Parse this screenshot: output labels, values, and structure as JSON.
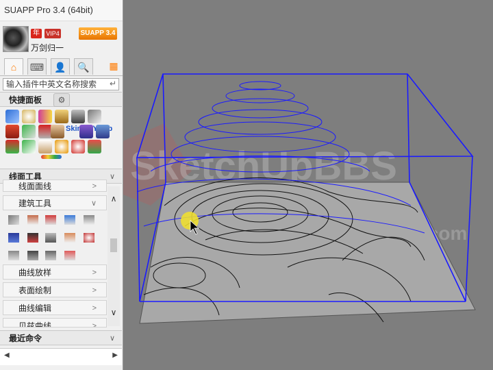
{
  "app": {
    "title": "SUAPP Pro 3.4 (64bit)"
  },
  "user": {
    "name": "万剑归一",
    "badge_year": "年",
    "badge_vip": "VIP4",
    "version_badge": "SUAPP 3.4"
  },
  "tabs": [
    {
      "name": "home-icon",
      "glyph": "⌂"
    },
    {
      "name": "keyboard-icon",
      "glyph": "⌨"
    },
    {
      "name": "user-icon",
      "glyph": "👤"
    },
    {
      "name": "search-icon",
      "glyph": "🔍"
    }
  ],
  "grid_icon": "▦",
  "search": {
    "placeholder": "输入插件中英文名称搜索",
    "enter_glyph": "↵"
  },
  "sections": {
    "quick_panel": {
      "label": "快捷面板",
      "gear_glyph": "⚙"
    },
    "line_tools": {
      "label": "线面工具",
      "chev": "∨"
    },
    "recent": {
      "label": "最近命令",
      "chev": "∨"
    }
  },
  "quick_panel": {
    "skin_label": "SkinX / YBub"
  },
  "subcategories": [
    {
      "label": "线面面线",
      "arrow": ">"
    },
    {
      "label": "建筑工具",
      "arrow": "∨"
    },
    {
      "label": "曲线放样",
      "arrow": ">"
    },
    {
      "label": "表面绘制",
      "arrow": ">"
    },
    {
      "label": "曲线编辑",
      "arrow": ">"
    },
    {
      "label": "贝兹曲线",
      "arrow": ">"
    }
  ],
  "scroll": {
    "up": "∧",
    "down": "∨"
  },
  "recent_bar": {
    "left_arrow": "◀",
    "right_arrow": "▶"
  },
  "watermark": {
    "text": "SketchUpBBS",
    "url": "www.sketchupbar.com"
  },
  "colors": {
    "accent": "#ff7a00",
    "bbox": "#1a1aff",
    "viewport_bg": "#7e7e7e",
    "ground": "#a8a8a8"
  }
}
